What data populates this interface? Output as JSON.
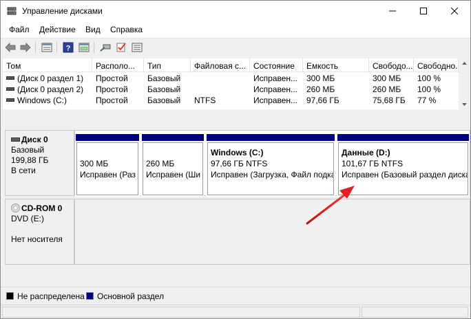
{
  "window": {
    "title": "Управление дисками",
    "minimize_icon": "minimize-icon",
    "maximize_icon": "maximize-icon",
    "close_icon": "close-icon"
  },
  "menu": [
    "Файл",
    "Действие",
    "Вид",
    "Справка"
  ],
  "toolbar": {
    "icons": [
      "back-arrow-icon",
      "forward-arrow-icon",
      "disk-list-icon",
      "help-icon",
      "properties-icon",
      "connect-icon",
      "check-icon",
      "settings-list-icon"
    ]
  },
  "volume_list": {
    "columns": [
      "Том",
      "Располо...",
      "Тип",
      "Файловая с...",
      "Состояние",
      "Емкость",
      "Свободо...",
      "Свободно..."
    ],
    "rows": [
      [
        "(Диск 0 раздел 1)",
        "Простой",
        "Базовый",
        "",
        "Исправен...",
        "300 МБ",
        "300 МБ",
        "100 %"
      ],
      [
        "(Диск 0 раздел 2)",
        "Простой",
        "Базовый",
        "",
        "Исправен...",
        "260 МБ",
        "260 МБ",
        "100 %"
      ],
      [
        "Windows (C:)",
        "Простой",
        "Базовый",
        "NTFS",
        "Исправен...",
        "97,66 ГБ",
        "75,68 ГБ",
        "77 %"
      ]
    ]
  },
  "disks": {
    "disk0": {
      "name": "Диск 0",
      "type": "Базовый",
      "size": "199,88 ГБ",
      "status": "В сети",
      "partitions": [
        {
          "name": "",
          "size": "300 МБ",
          "state": "Исправен (Раз"
        },
        {
          "name": "",
          "size": "260 МБ",
          "state": "Исправен (Ши"
        },
        {
          "name": "Windows  (C:)",
          "size": "97,66 ГБ NTFS",
          "state": "Исправен (Загрузка, Файл подка"
        },
        {
          "name": "Данные  (D:)",
          "size": "101,67 ГБ NTFS",
          "state": "Исправен (Базовый раздел диска"
        }
      ]
    },
    "cdrom0": {
      "name": "CD-ROM 0",
      "drive": "DVD (E:)",
      "status": "Нет носителя"
    }
  },
  "legend": [
    {
      "label": "Не распределена",
      "color": "#000000"
    },
    {
      "label": "Основной раздел",
      "color": "#00007f"
    }
  ],
  "colors": {
    "partition_bar": "#00007f",
    "annotation_arrow": "#e02020"
  }
}
